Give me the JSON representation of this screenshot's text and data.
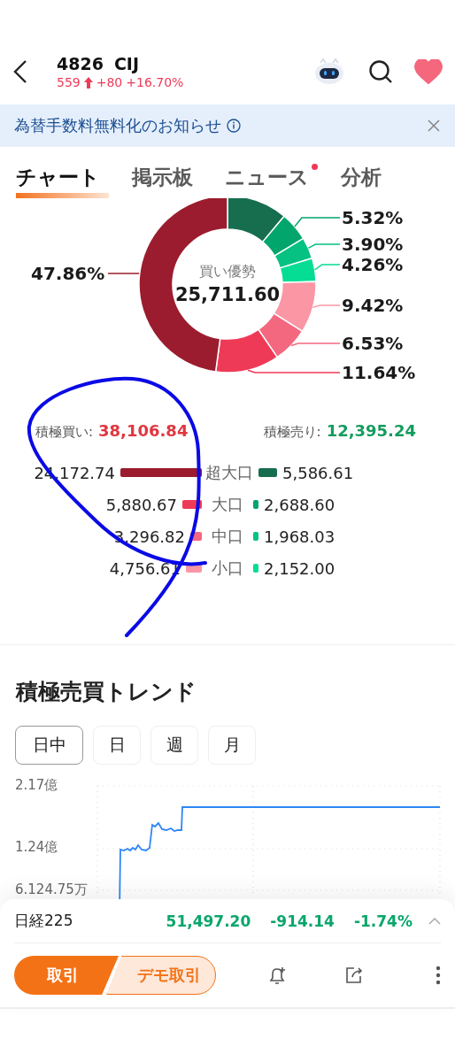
{
  "header": {
    "code": "4826",
    "name": "CIJ",
    "price": "559",
    "change": "+80",
    "change_pct": "+16.70%",
    "favorite": true
  },
  "banner": {
    "text": "為替手数料無料化のお知らせ"
  },
  "tabs": [
    {
      "label": "チャート",
      "selected": true,
      "new": false
    },
    {
      "label": "掲示板",
      "selected": false,
      "new": false
    },
    {
      "label": "ニュース",
      "selected": false,
      "new": true
    },
    {
      "label": "分析",
      "selected": false,
      "new": false
    }
  ],
  "donut": {
    "center_label": "買い優勢",
    "center_value": "25,711.60",
    "chart_data": {
      "type": "donut",
      "values": [
        11.06,
        5.32,
        3.9,
        4.26,
        9.42,
        6.53,
        11.64,
        47.86
      ],
      "colors": [
        "#176e4f",
        "#02a56c",
        "#05c283",
        "#04dd93",
        "#fb96a5",
        "#f4687f",
        "#ef3a57",
        "#9b1c2e"
      ],
      "value_labels": [
        null,
        "5.32%",
        "3.90%",
        "4.26%",
        "9.42%",
        "6.53%",
        "11.64%",
        "47.86%"
      ]
    }
  },
  "summary": {
    "buy_label": "積極買い:",
    "buy_value": "38,106.84",
    "sell_label": "積極売り:",
    "sell_value": "12,395.24"
  },
  "flows": [
    {
      "label": "超大口",
      "buy": {
        "value": "24,172.74",
        "color": "#9b1c2e"
      },
      "sell": {
        "value": "5,586.61",
        "color": "#176e4f"
      }
    },
    {
      "label": "大口",
      "buy": {
        "value": "5,880.67",
        "color": "#ef3a57"
      },
      "sell": {
        "value": "2,688.60",
        "color": "#02a56c"
      }
    },
    {
      "label": "中口",
      "buy": {
        "value": "3,296.82",
        "color": "#f4687f"
      },
      "sell": {
        "value": "1,968.03",
        "color": "#05c283"
      }
    },
    {
      "label": "小口",
      "buy": {
        "value": "4,756.61",
        "color": "#fb96a5"
      },
      "sell": {
        "value": "2,152.00",
        "color": "#04dd93"
      }
    }
  ],
  "trend": {
    "title": "積極売買トレンド",
    "periods": [
      {
        "label": "日中",
        "selected": true
      },
      {
        "label": "日",
        "selected": false
      },
      {
        "label": "週",
        "selected": false
      },
      {
        "label": "月",
        "selected": false
      }
    ],
    "y_labels": [
      "2.17億",
      "1.24億",
      "6.124.75万"
    ]
  },
  "index_bar": {
    "name": "日経225",
    "value": "51,497.20",
    "change": "-914.14",
    "change_pct": "-1.74%"
  },
  "actions": {
    "trade": "取引",
    "demo": "デモ取引"
  },
  "annotation": {
    "kind": "scribble"
  }
}
